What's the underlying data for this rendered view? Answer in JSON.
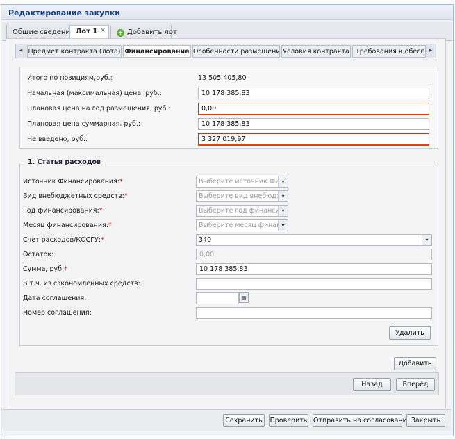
{
  "window": {
    "title": "Редактирование закупки"
  },
  "top_tabs": [
    {
      "label": "Общие сведения"
    },
    {
      "label": "Лот 1",
      "close": "×"
    },
    {
      "label": "Добавить лот"
    }
  ],
  "inner_tabs": {
    "scroll_left": "◂",
    "scroll_right": "▸",
    "items": [
      {
        "label": "Предмет контракта (лота)"
      },
      {
        "label": "Финансирование"
      },
      {
        "label": "Особенности размещения"
      },
      {
        "label": "Условия контракта"
      },
      {
        "label": "Требования к обеспечению"
      }
    ]
  },
  "summary": {
    "total_label": "Итого по позициям,руб.:",
    "total_value": "13 505 405,80",
    "initial_price_label": "Начальная (максимальная) цена, руб.:",
    "initial_price_value": "10 178 385,83",
    "planned_year_label": "Плановая цена на год размещения, руб.:",
    "planned_year_value": "0,00",
    "planned_total_label": "Плановая цена суммарная, руб.:",
    "planned_total_value": "10 178 385,83",
    "not_entered_label": "Не введено, руб.:",
    "not_entered_value": "3 327 019,97"
  },
  "expense": {
    "legend": "1. Статья расходов",
    "source_label": "Источник Финансирования:",
    "source_placeholder": "Выберите источник Фи",
    "extrabudget_label": "Вид внебюджетных средств:",
    "extrabudget_placeholder": "Выберите вид внебюдж",
    "year_label": "Год финансирования:",
    "year_placeholder": "Выберите год финансир",
    "month_label": "Месяц финансирования:",
    "month_placeholder": "Выберите месяц финан",
    "account_label": "Счет расходов/КОСГУ:",
    "account_value": "340",
    "remainder_label": "Остаток:",
    "remainder_value": "0,00",
    "sum_label": "Сумма, руб:",
    "sum_value": "10 178 385,83",
    "saved_label": "В т.ч. из сэкономленных средств:",
    "saved_value": "",
    "agreement_date_label": "Дата соглашения:",
    "agreement_date_value": "",
    "agreement_number_label": "Номер соглашения:",
    "agreement_number_value": "",
    "required_mark": "*",
    "delete_button": "Удалить"
  },
  "add_button": "Добавить",
  "nav": {
    "back": "Назад",
    "forward": "Вперёд"
  },
  "footer": {
    "save": "Сохранить",
    "check": "Проверить",
    "send": "Отправить на согласование",
    "close": "Закрыть"
  },
  "icons": {
    "dropdown": "▾",
    "calendar": "▦",
    "add": "+"
  }
}
